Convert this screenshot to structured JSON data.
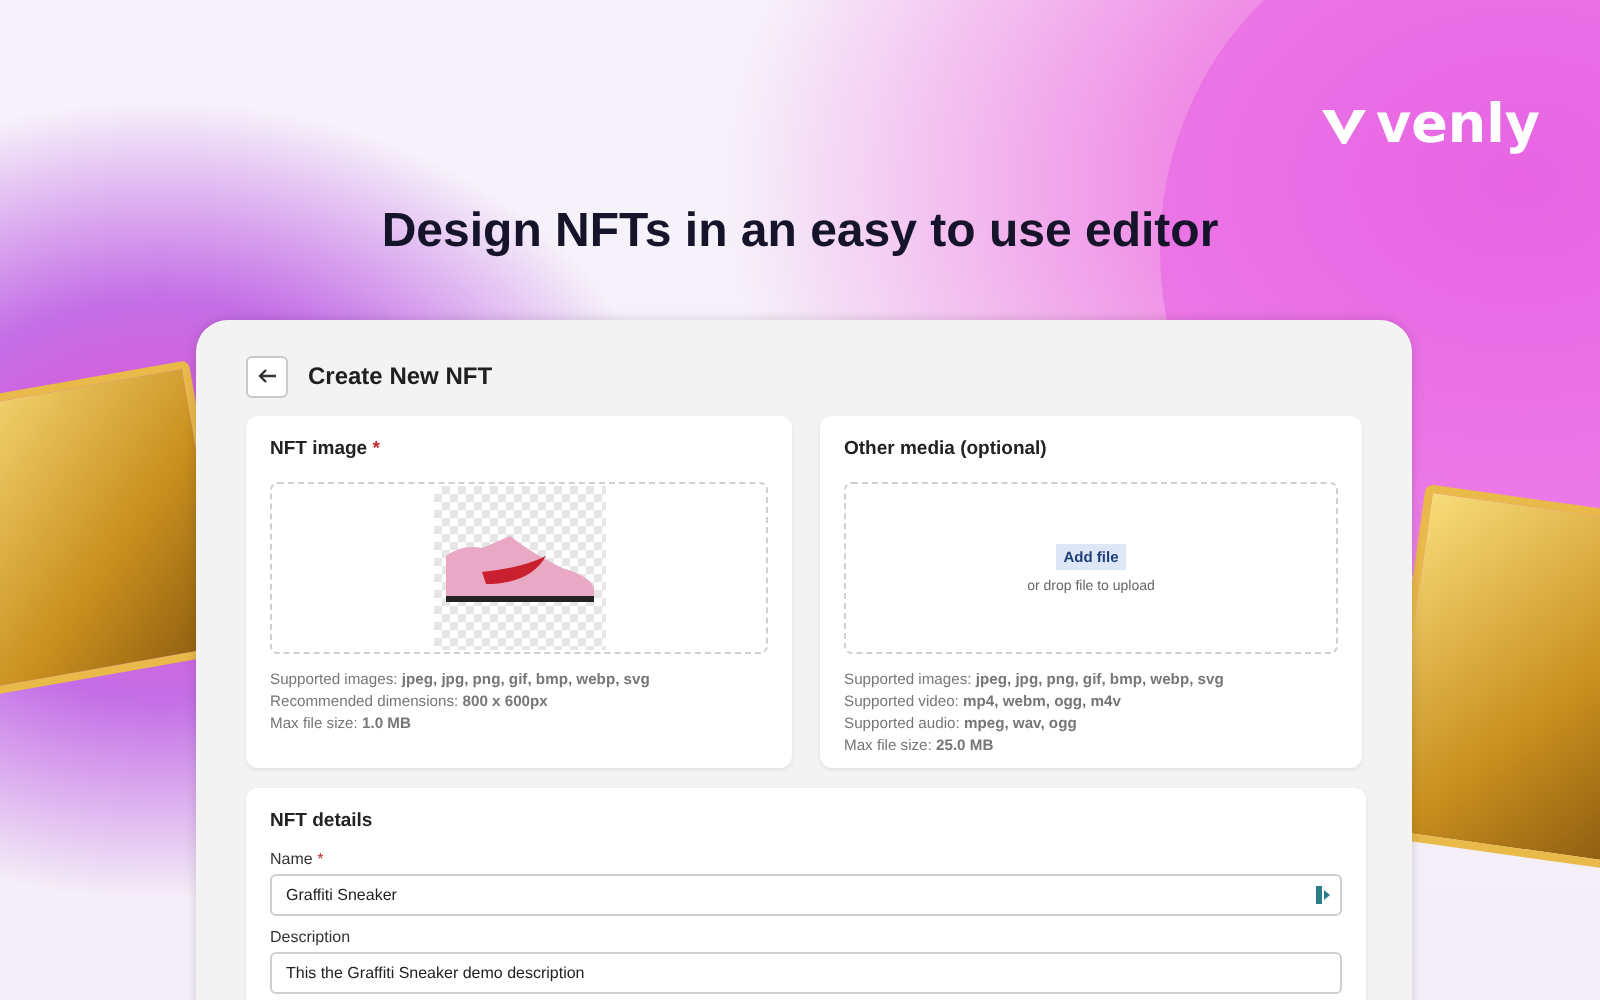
{
  "logo": {
    "text": "venly"
  },
  "headline": "Design NFTs in an easy to use editor",
  "window": {
    "title": "Create New NFT"
  },
  "image_card": {
    "title": "NFT image",
    "mark": "*",
    "info": [
      "Supported images: **jpeg, jpg, png, gif, bmp, webp, svg**",
      "Recommended dimensions: **800 x 600px**",
      "Max file size: **1.0 MB**"
    ]
  },
  "media_card": {
    "title": "Other media (optional)",
    "button": "Add file",
    "hint": "or drop file to upload",
    "info": [
      "Supported images: **jpeg, jpg, png, gif, bmp, webp, svg**",
      "Supported video: **mp4, webm, ogg, m4v**",
      "Supported audio: **mpeg, wav, ogg**",
      "Max file size: **25.0 MB**"
    ]
  },
  "details": {
    "title": "NFT details",
    "fields": [
      {
        "label": "Name",
        "mark": "*",
        "value": "Graffiti Sneaker"
      },
      {
        "label": "Description",
        "value": "This the Graffiti Sneaker demo description"
      }
    ]
  }
}
